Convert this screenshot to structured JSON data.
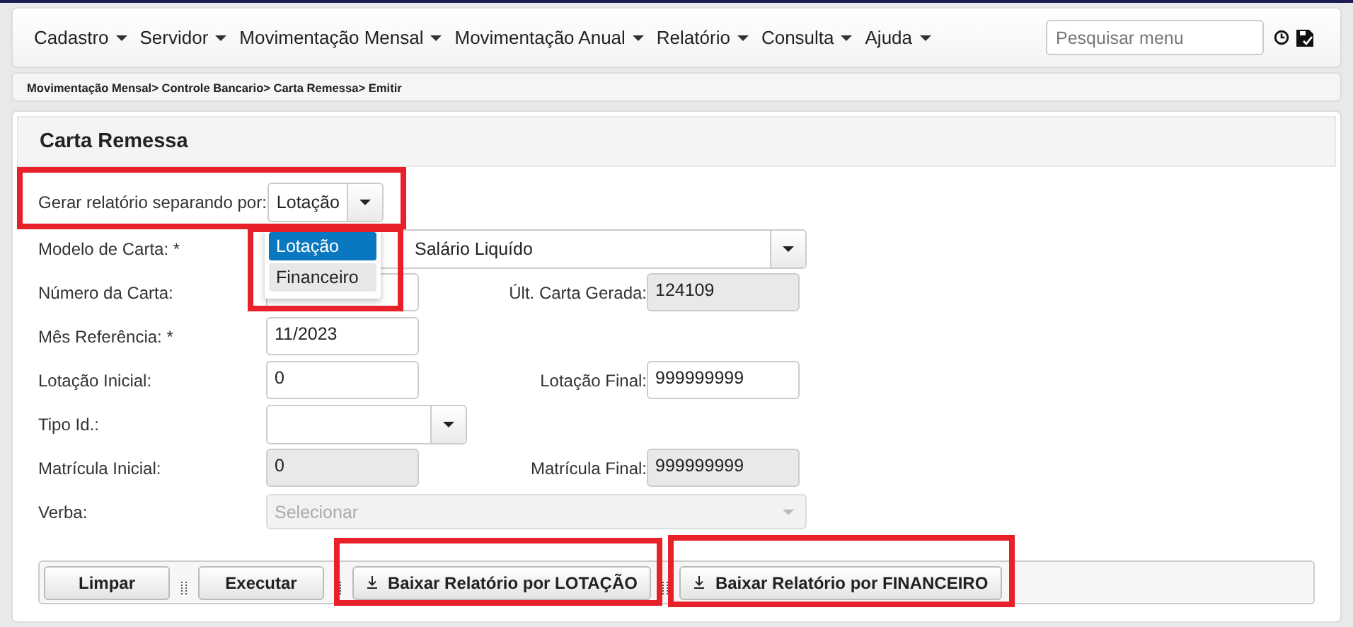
{
  "menu": {
    "items": [
      {
        "label": "Cadastro"
      },
      {
        "label": "Servidor"
      },
      {
        "label": "Movimentação Mensal"
      },
      {
        "label": "Movimentação Anual"
      },
      {
        "label": "Relatório"
      },
      {
        "label": "Consulta"
      },
      {
        "label": "Ajuda"
      }
    ],
    "search": {
      "placeholder": "Pesquisar menu"
    }
  },
  "breadcrumb": "Movimentação Mensal> Controle Bancario> Carta Remessa> Emitir",
  "panel": {
    "title": "Carta Remessa",
    "rows": [
      {
        "label": "Gerar relatório separando por:",
        "field": {
          "kind": "combo",
          "value": "Lotação"
        }
      },
      {
        "label": "Modelo de Carta: *",
        "field": {
          "kind": "wide-select",
          "value": "Salário Liquído"
        }
      },
      {
        "label": "Número da Carta:",
        "field": {
          "kind": "text"
        },
        "side": {
          "label": "Últ. Carta Gerada:",
          "kind": "readonly",
          "value": "124109"
        }
      },
      {
        "label": "Mês Referência: *",
        "field": {
          "kind": "text",
          "value": "11/2023"
        }
      },
      {
        "label": "Lotação Inicial:",
        "field": {
          "kind": "text",
          "value": "0"
        },
        "side": {
          "label": "Lotação Final:",
          "kind": "text",
          "value": "999999999"
        }
      },
      {
        "label": "Tipo Id.:",
        "field": {
          "kind": "select"
        }
      },
      {
        "label": "Matrícula Inicial:",
        "field": {
          "kind": "readonly",
          "value": "0"
        },
        "side": {
          "label": "Matrícula Final:",
          "kind": "readonly",
          "value": "999999999"
        }
      },
      {
        "label": "Verba:",
        "field": {
          "kind": "wide-select",
          "placeholder": "Selecionar",
          "disabled": true
        }
      }
    ],
    "dropdown": {
      "options": [
        {
          "label": "Lotação",
          "selected": true
        },
        {
          "label": "Financeiro",
          "selected": false
        }
      ]
    },
    "buttons": [
      {
        "label": "Limpar",
        "kind": "plain"
      },
      {
        "label": "Executar",
        "kind": "plain"
      },
      {
        "label": "Baixar Relatório por LOTAÇÃO",
        "kind": "download"
      },
      {
        "label": "Baixar Relatório por FINANCEIRO",
        "kind": "download"
      }
    ]
  }
}
